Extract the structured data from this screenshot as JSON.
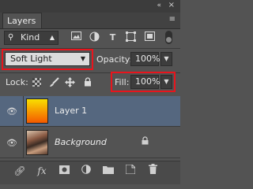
{
  "header": {
    "collapse_icon": "«",
    "close_icon": "×"
  },
  "tabs": [
    {
      "label": "Layers"
    }
  ],
  "panel_menu_icon": "≡",
  "filter": {
    "icon": "search-icon",
    "kind_label": "Kind",
    "icons": [
      "image-filter-icon",
      "adjustment-filter-icon",
      "type-filter-icon",
      "shape-filter-icon",
      "smart-object-filter-icon"
    ]
  },
  "blend": {
    "mode_value": "Soft Light",
    "opacity_label": "Opacity:",
    "opacity_value": "100%"
  },
  "lock": {
    "label": "Lock:",
    "fill_label": "Fill:",
    "fill_value": "100%"
  },
  "layers": [
    {
      "name": "Layer 1",
      "selected": true,
      "visible": true,
      "thumbnail": "gradient yellow-orange"
    },
    {
      "name": "Background",
      "selected": false,
      "visible": true,
      "locked": true,
      "thumbnail": "photo"
    }
  ],
  "bottom_icons": [
    "link-layers-icon",
    "fx-icon",
    "add-mask-icon",
    "adjustment-layer-icon",
    "new-group-icon",
    "new-layer-icon",
    "delete-layer-icon"
  ],
  "highlight_color": "#e8141c",
  "selection_color": "#55677f"
}
